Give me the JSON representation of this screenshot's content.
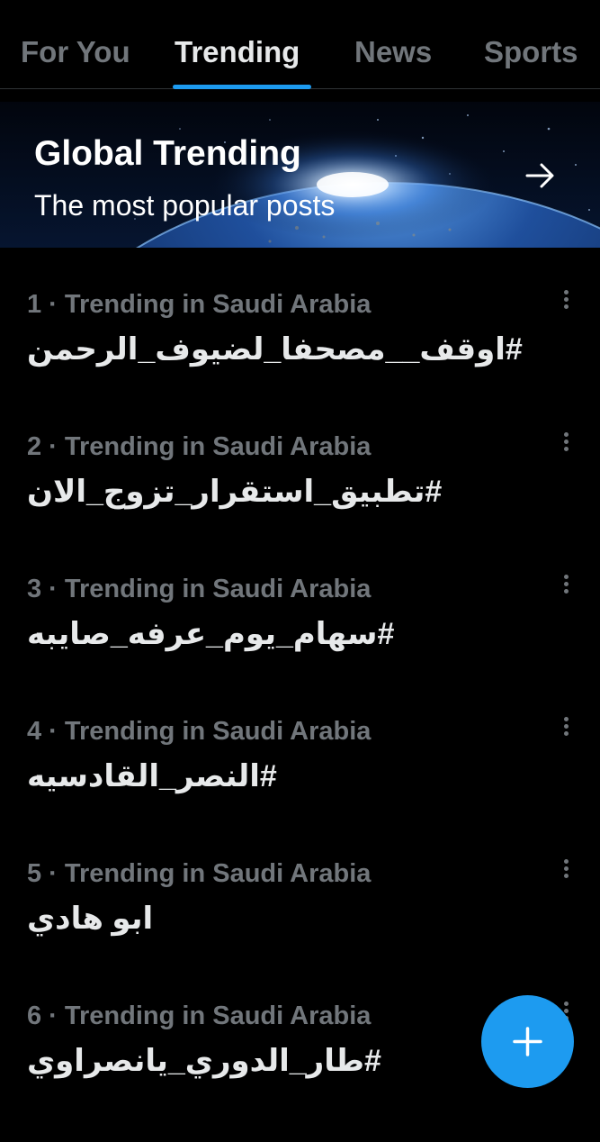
{
  "tabs": [
    {
      "label": "For You",
      "active": false
    },
    {
      "label": "Trending",
      "active": true
    },
    {
      "label": "News",
      "active": false
    },
    {
      "label": "Sports",
      "active": false
    }
  ],
  "banner": {
    "title": "Global Trending",
    "subtitle": "The most popular posts",
    "arrow_icon": "arrow-right-icon"
  },
  "trends": [
    {
      "meta": "1 · Trending in Saudi Arabia",
      "name": "#اوقف__مصحفا_لضيوف_الرحمن"
    },
    {
      "meta": "2 · Trending in Saudi Arabia",
      "name": "#تطبيق_استقرار_تزوج_الان"
    },
    {
      "meta": "3 · Trending in Saudi Arabia",
      "name": "#سهام_يوم_عرفه_صايبه"
    },
    {
      "meta": "4 · Trending in Saudi Arabia",
      "name": "#النصر_القادسيه"
    },
    {
      "meta": "5 · Trending in Saudi Arabia",
      "name": "ابو هادي"
    },
    {
      "meta": "6 · Trending in Saudi Arabia",
      "name": "#طار_الدوري_يانصراوي"
    }
  ],
  "fab": {
    "icon": "plus-icon"
  },
  "colors": {
    "background": "#000000",
    "accent": "#1d9bf0",
    "primary_text": "#e7e9ea",
    "secondary_text": "#71767b"
  }
}
